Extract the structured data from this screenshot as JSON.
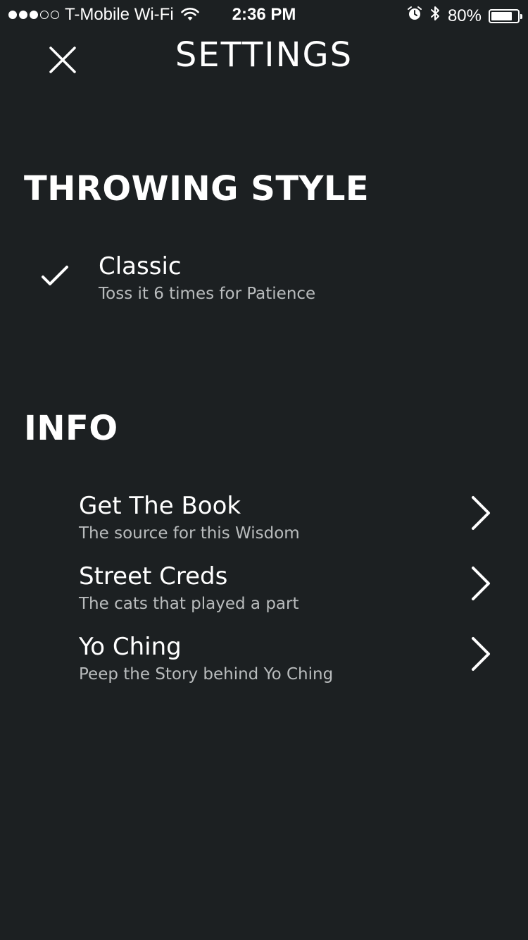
{
  "status_bar": {
    "signal_dots": [
      true,
      true,
      true,
      false,
      false
    ],
    "carrier": "T-Mobile Wi-Fi",
    "time": "2:36 PM",
    "battery_percent": "80%",
    "battery_level": 0.8,
    "icons": [
      "wifi-icon",
      "alarm-icon",
      "bluetooth-icon",
      "battery-icon"
    ]
  },
  "header": {
    "title": "SETTINGS",
    "close_icon": "close-icon"
  },
  "throwing_style": {
    "heading": "THROWING STYLE",
    "options": [
      {
        "title": "Classic",
        "subtitle": "Toss it 6 times for Patience",
        "selected": true
      }
    ]
  },
  "info": {
    "heading": "INFO",
    "items": [
      {
        "title": "Get The Book",
        "subtitle": "The source for this Wisdom"
      },
      {
        "title": "Street Creds",
        "subtitle": "The cats that played a part"
      },
      {
        "title": "Yo Ching",
        "subtitle": "Peep the Story behind Yo Ching"
      }
    ]
  },
  "colors": {
    "background": "#1c2022",
    "text_primary": "#ffffff",
    "text_secondary": "#b9bcbd"
  }
}
